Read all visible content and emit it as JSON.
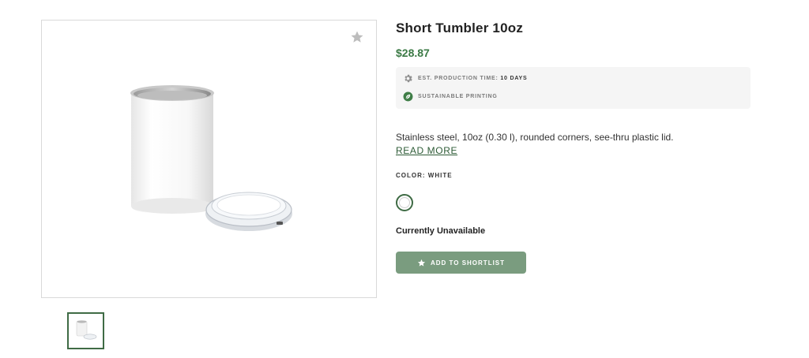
{
  "product": {
    "title": "Short Tumbler 10oz",
    "price": "$28.87",
    "specs": {
      "production_label": "EST. PRODUCTION TIME:",
      "production_value": "10 DAYS",
      "sustainable_label": "SUSTAINABLE PRINTING"
    },
    "description": "Stainless steel, 10oz (0.30 l), rounded corners, see-thru plastic lid.",
    "read_more": "READ MORE",
    "color_label": "COLOR: WHITE",
    "availability": "Currently Unavailable",
    "shortlist_button": "ADD TO SHORTLIST",
    "selected_color": "White"
  },
  "icons": {
    "favorite": "star-icon",
    "production": "gear-icon",
    "sustainable": "leaf-icon",
    "button": "star-icon"
  },
  "colors": {
    "brand_green": "#3b7a45",
    "button_green": "#7a9c7f",
    "spec_bg": "#f5f5f5"
  }
}
